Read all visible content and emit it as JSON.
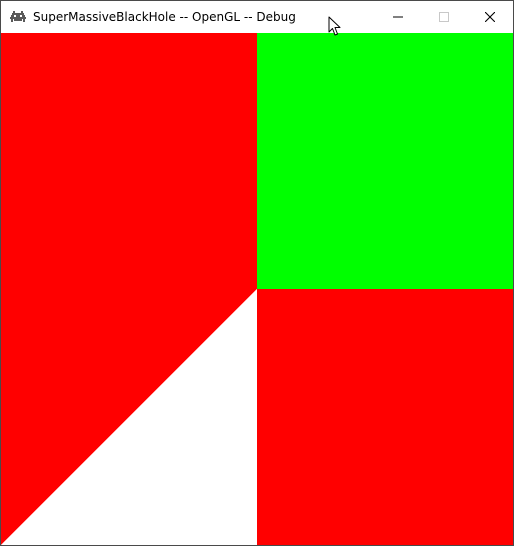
{
  "window": {
    "title": "SuperMassiveBlackHole -- OpenGL -- Debug",
    "app_icon": "space-invader-icon",
    "controls": {
      "minimize_icon": "minimize-icon",
      "maximize_icon": "maximize-icon",
      "close_icon": "close-icon"
    }
  },
  "cursor": {
    "icon": "mouse-pointer-icon"
  },
  "viewport": {
    "colors": {
      "background": "#ffffff",
      "red": "#ff0000",
      "green": "#00ff00"
    },
    "shapes": [
      "left-red-trapezoid",
      "top-right-green-quad",
      "bottom-right-red-quad",
      "bottom-left-white-triangle"
    ]
  }
}
